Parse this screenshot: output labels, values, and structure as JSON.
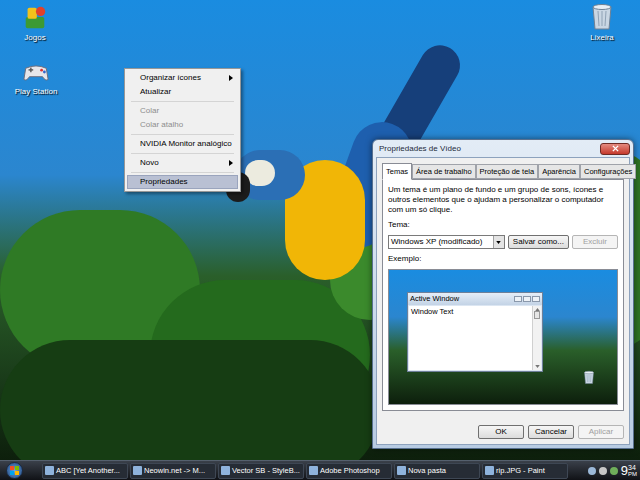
{
  "desktop_icons": [
    {
      "label": "Jogos"
    },
    {
      "label": "Play Station"
    },
    {
      "label": "Lixeira"
    }
  ],
  "context_menu": {
    "groups": [
      [
        {
          "label": "Organizar ícones",
          "submenu": true,
          "disabled": false,
          "selected": false
        },
        {
          "label": "Atualizar",
          "submenu": false,
          "disabled": false,
          "selected": false
        }
      ],
      [
        {
          "label": "Colar",
          "submenu": false,
          "disabled": true,
          "selected": false
        },
        {
          "label": "Colar atalho",
          "submenu": false,
          "disabled": true,
          "selected": false
        }
      ],
      [
        {
          "label": "NVIDIA Monitor analógico",
          "submenu": false,
          "disabled": false,
          "selected": false
        }
      ],
      [
        {
          "label": "Novo",
          "submenu": true,
          "disabled": false,
          "selected": false
        }
      ],
      [
        {
          "label": "Propriedades",
          "submenu": false,
          "disabled": false,
          "selected": true
        }
      ]
    ]
  },
  "dialog": {
    "title": "Propriedades de Vídeo",
    "tabs": [
      {
        "label": "Temas",
        "selected": true
      },
      {
        "label": "Área de trabalho",
        "selected": false
      },
      {
        "label": "Proteção de tela",
        "selected": false
      },
      {
        "label": "Aparência",
        "selected": false
      },
      {
        "label": "Configurações",
        "selected": false
      }
    ],
    "description": "Um tema é um plano de fundo e um grupo de sons, ícones e outros elementos que o ajudam a personalizar o computador com um só clique.",
    "theme_label": "Tema:",
    "theme_value": "Windows XP (modificado)",
    "theme_buttons": [
      {
        "label": "Salvar como...",
        "disabled": false
      },
      {
        "label": "Excluir",
        "disabled": true
      }
    ],
    "preview_label": "Exemplo:",
    "preview": {
      "window_title": "Active Window",
      "window_text": "Window Text"
    },
    "buttons": [
      {
        "label": "OK",
        "disabled": false
      },
      {
        "label": "Cancelar",
        "disabled": false
      },
      {
        "label": "Aplicar",
        "disabled": true
      }
    ]
  },
  "taskbar": {
    "tasks": [
      {
        "label": "ABC [Yet Another...",
        "selected": false
      },
      {
        "label": "Neowin.net -> M...",
        "selected": false
      },
      {
        "label": "Vector SB - StyleB...",
        "selected": false
      },
      {
        "label": "Adobe Photoshop",
        "selected": false
      },
      {
        "label": "Nova pasta",
        "selected": false
      },
      {
        "label": "rip.JPG - Paint",
        "selected": false
      }
    ],
    "clock": {
      "hour": "9",
      "minute": "34",
      "period": "PM"
    }
  }
}
